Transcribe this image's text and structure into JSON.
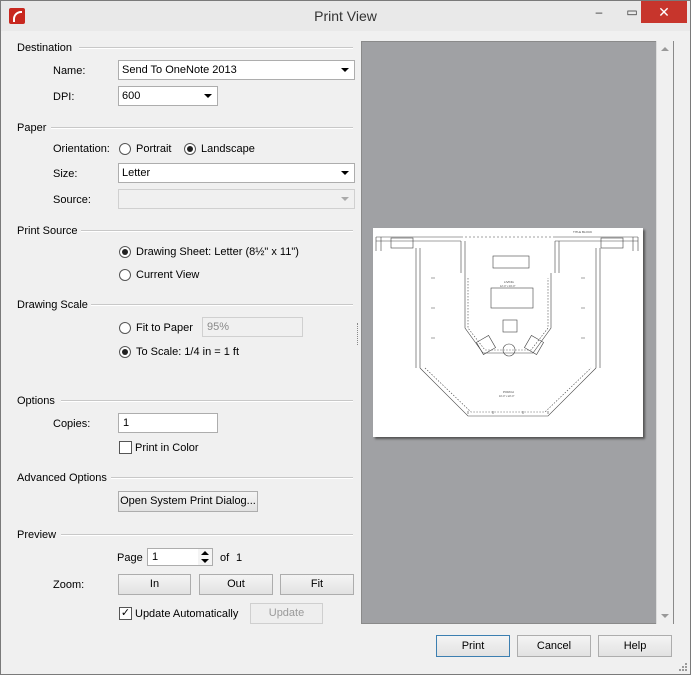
{
  "window": {
    "title": "Print View",
    "min_icon": "minimize-icon",
    "max_icon": "maximize-icon",
    "close_icon": "close-icon",
    "min_glyph": "–",
    "max_glyph": "▭",
    "close_glyph": "✕"
  },
  "destination": {
    "section": "Destination",
    "name_label": "Name:",
    "name_value": "Send To OneNote 2013",
    "dpi_label": "DPI:",
    "dpi_value": "600"
  },
  "paper": {
    "section": "Paper",
    "orientation_label": "Orientation:",
    "portrait": "Portrait",
    "landscape": "Landscape",
    "selected": "Landscape",
    "size_label": "Size:",
    "size_value": "Letter",
    "source_label": "Source:",
    "source_value": ""
  },
  "print_source": {
    "section": "Print Source",
    "drawing_sheet": "Drawing Sheet: Letter  (8½\" x 11\")",
    "current_view": "Current View",
    "selected": "Drawing Sheet"
  },
  "drawing_scale": {
    "section": "Drawing Scale",
    "fit_to_paper": "Fit to Paper",
    "fit_value": "95%",
    "to_scale": "To Scale: 1/4 in = 1 ft",
    "selected": "To Scale"
  },
  "options": {
    "section": "Options",
    "copies_label": "Copies:",
    "copies_value": "1",
    "print_in_color": "Print in Color",
    "print_in_color_checked": false
  },
  "advanced": {
    "section": "Advanced Options",
    "system_dialog_button": "Open System Print Dialog..."
  },
  "preview_section": {
    "section": "Preview",
    "page_label": "Page",
    "page_value": "1",
    "of_label": "of",
    "page_count": "1",
    "zoom_label": "Zoom:",
    "zoom_in": "In",
    "zoom_out": "Out",
    "zoom_fit": "Fit",
    "update_auto": "Update Automatically",
    "update_auto_checked": true,
    "update_button": "Update"
  },
  "plan_text": {
    "title_block": "TITLE BLOCK",
    "room1": "LIVING",
    "room1_sub": "12'-0\" x 16'-0\"",
    "room2": "PORCH",
    "room2_sub": "10'-0\" x 22'-0\""
  },
  "footer": {
    "print": "Print",
    "cancel": "Cancel",
    "help": "Help"
  },
  "colors": {
    "preview_bg": "#a0a1a4",
    "close_red": "#c7352c",
    "accent": "#3c7fb1"
  }
}
